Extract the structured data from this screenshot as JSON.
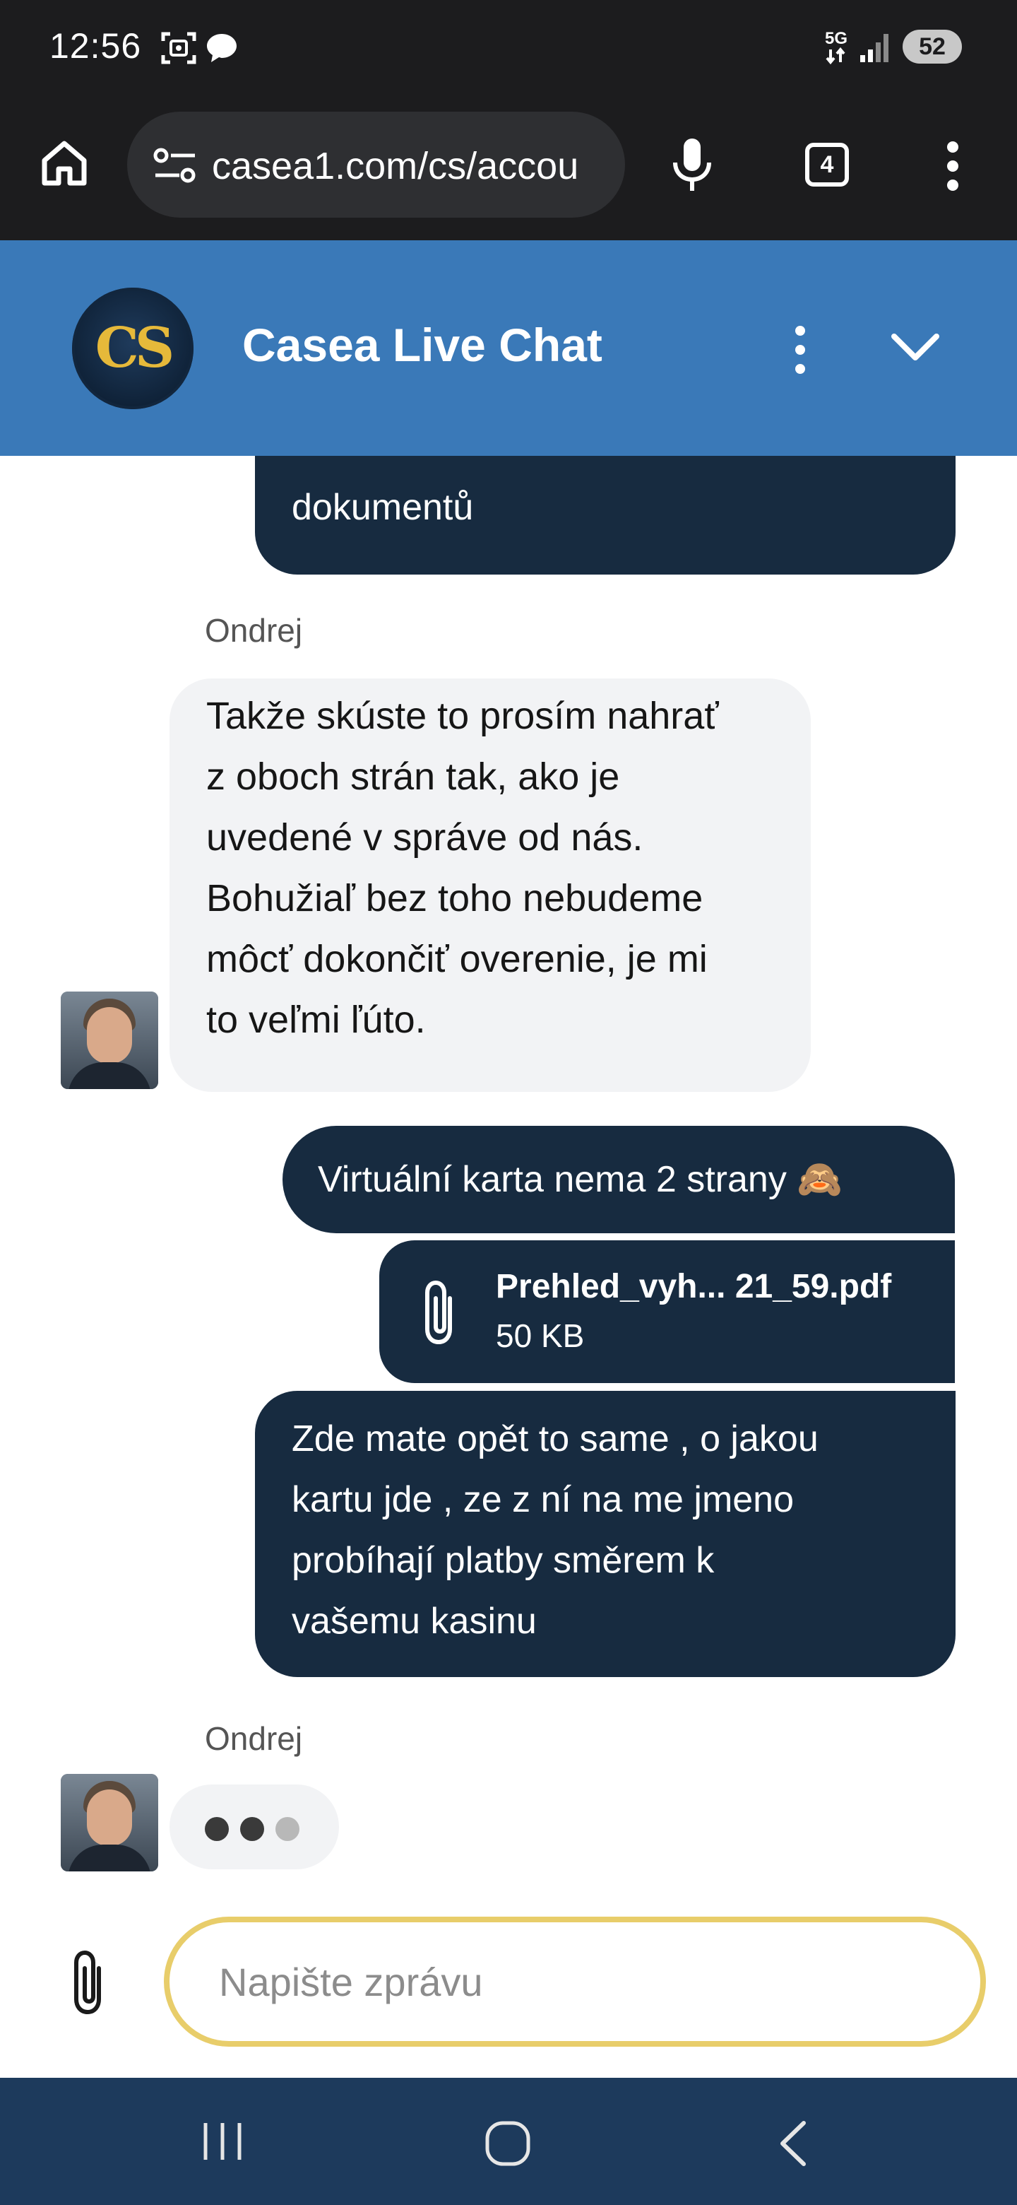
{
  "status_bar": {
    "time": "12:56",
    "network": "5G",
    "battery": "52"
  },
  "browser": {
    "url": "casea1.com/cs/accou",
    "tab_count": "4"
  },
  "chat_header": {
    "logo_text": "CS",
    "title": "Casea Live Chat"
  },
  "messages": [
    {
      "type": "outgoing",
      "text": "moje složka má už miliony dokumentů",
      "visible_text": "dokumentů"
    },
    {
      "type": "sender",
      "name": "Ondrej"
    },
    {
      "type": "incoming",
      "lines": [
        "Takže skúste to prosím nahrať",
        "z oboch strán tak, ako je",
        "uvedené v správe od nás.",
        "Bohužiaľ bez toho nebudeme",
        "môcť dokončiť overenie, je mi",
        "to veľmi ľúto."
      ]
    },
    {
      "type": "outgoing",
      "text": "Virtuální karta nema 2 strany 🙈"
    },
    {
      "type": "file",
      "name": "Prehled_vyh... 21_59.pdf",
      "size": "50 KB"
    },
    {
      "type": "outgoing",
      "lines": [
        "Zde mate opět to same , o jakou",
        "kartu jde , ze z ní na me jmeno",
        "probíhají platby směrem k",
        "vašemu kasinu"
      ]
    },
    {
      "type": "sender",
      "name": "Ondrej"
    }
  ],
  "input": {
    "placeholder": "Napište zprávu"
  },
  "colors": {
    "header_bg": "#3a79b8",
    "outgoing_bubble": "#172b40",
    "incoming_bubble": "#f2f3f5",
    "input_border": "#e8cd6a",
    "nav_bg": "#1d3a5c"
  }
}
